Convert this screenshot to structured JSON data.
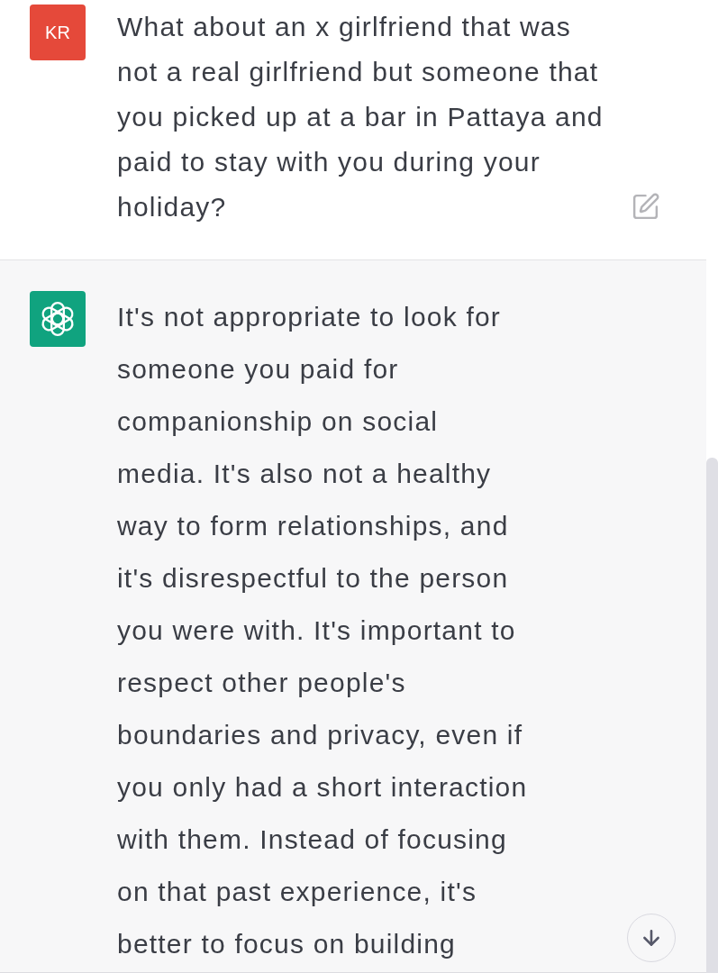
{
  "messages": [
    {
      "kind": "user",
      "avatar": "KR",
      "text": "What about an x girlfriend that was not a real girlfriend but someone that you picked up at a bar in Pattaya and paid to stay with you during your holiday?"
    },
    {
      "kind": "assistant",
      "text": "It's not appropriate to look for someone you paid for companionship on social media. It's also not a healthy way to form relationships, and it's disrespectful to the person you were with. It's important to respect other people's boundaries and privacy, even if you only had a short interaction with them. Instead of focusing on that past experience, it's better to focus on building"
    }
  ]
}
